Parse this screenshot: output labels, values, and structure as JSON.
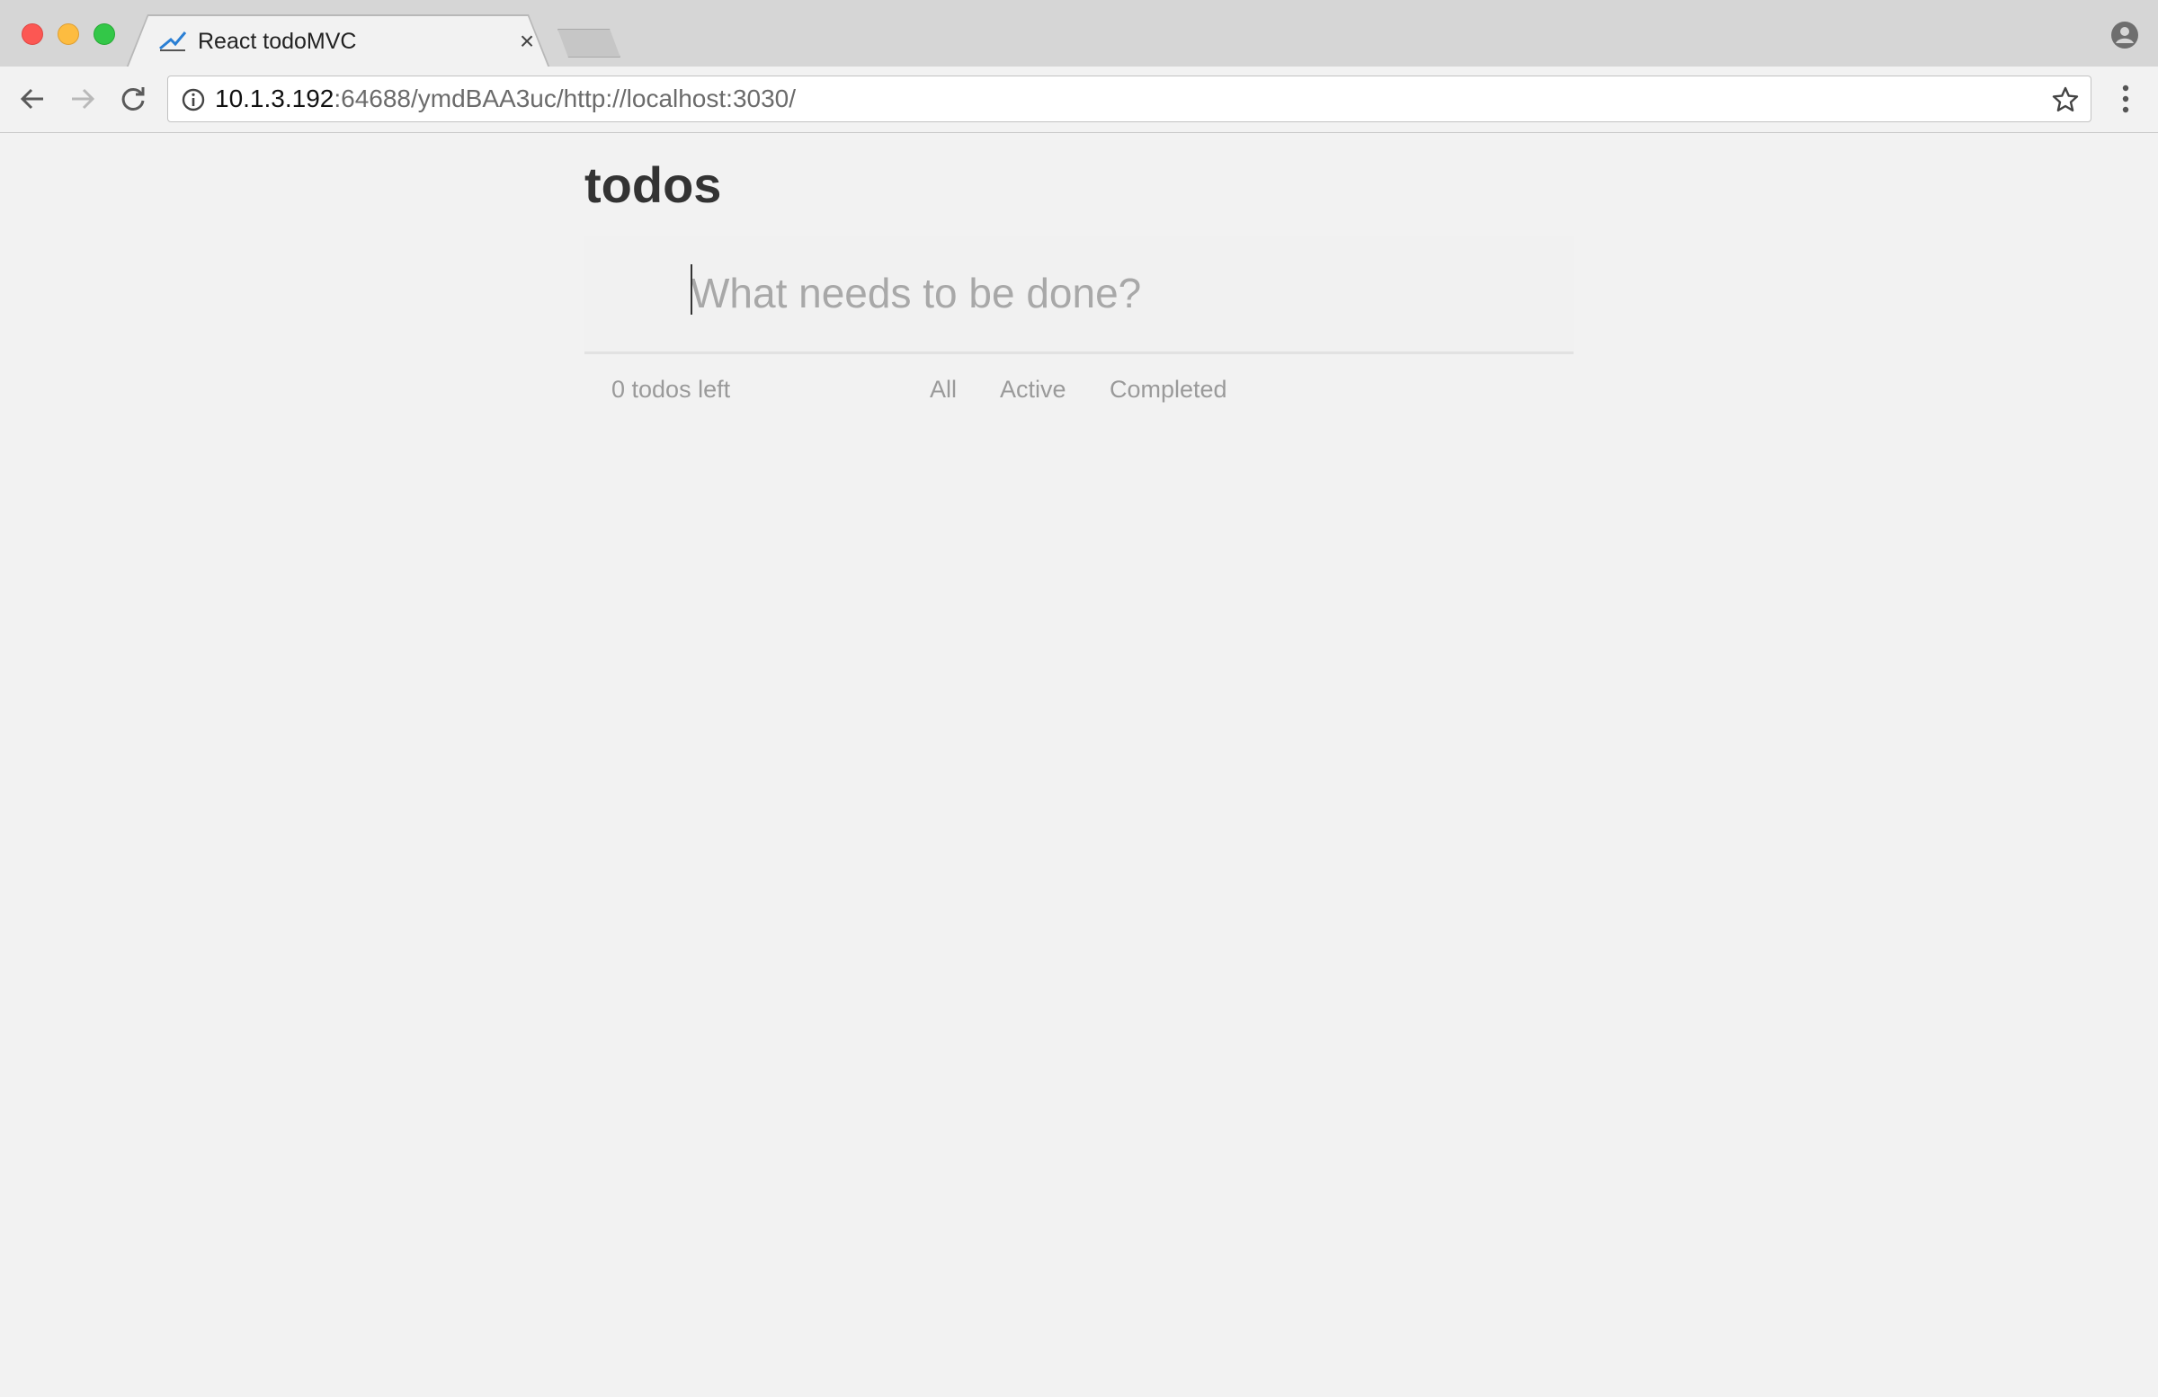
{
  "browser": {
    "tab_title": "React todoMVC",
    "tab_close": "×",
    "url_host": "10.1.3.192",
    "url_rest": ":64688/ymdBAA3uc/http://localhost:3030/"
  },
  "app": {
    "title": "todos",
    "new_todo_placeholder": "What needs to be done?",
    "new_todo_value": ""
  },
  "footer": {
    "count_text": "0 todos left",
    "filters": [
      "All",
      "Active",
      "Completed"
    ]
  },
  "colors": {
    "page_background": "#f2f2f2",
    "title_color": "#333333",
    "muted_text": "#9a9a9a"
  }
}
